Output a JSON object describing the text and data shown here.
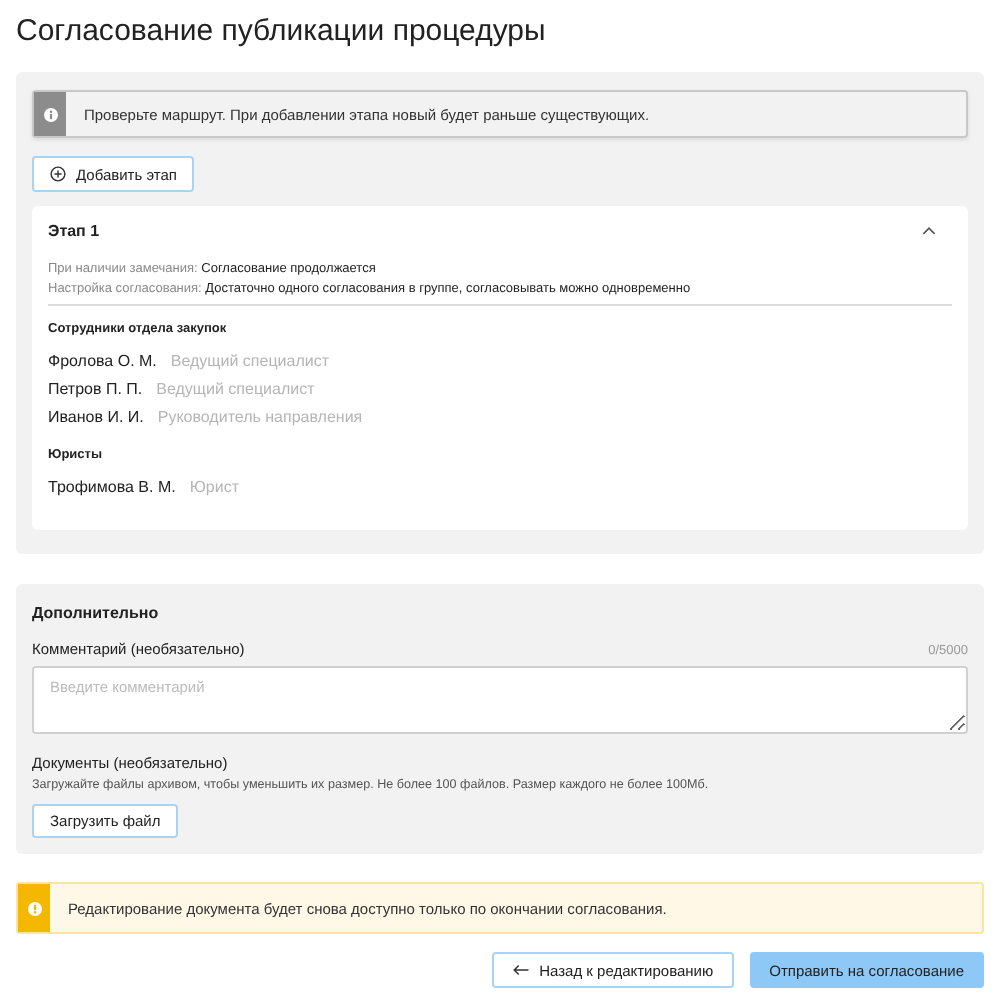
{
  "title": "Согласование публикации процедуры",
  "info_alert": {
    "text": "Проверьте маршрут. При добавлении этапа новый будет раньше существующих."
  },
  "add_stage_button": {
    "label": "Добавить этап"
  },
  "stages": [
    {
      "title": "Этап 1",
      "expanded": true,
      "settings": [
        {
          "label": "При наличии замечания:",
          "value": "Согласование продолжается"
        },
        {
          "label": "Настройка согласования:",
          "value": "Достаточно одного согласования в группе, согласовывать можно одновременно"
        }
      ],
      "groups": [
        {
          "name": "Сотрудники отдела закупок",
          "members": [
            {
              "name": "Фролова О. М.",
              "role": "Ведущий специалист"
            },
            {
              "name": "Петров П. П.",
              "role": "Ведущий специалист"
            },
            {
              "name": "Иванов И. И.",
              "role": "Руководитель направления"
            }
          ]
        },
        {
          "name": "Юристы",
          "members": [
            {
              "name": "Трофимова В. М.",
              "role": "Юрист"
            }
          ]
        }
      ]
    }
  ],
  "additional": {
    "title": "Дополнительно",
    "comment_label": "Комментарий (необязательно)",
    "comment_counter": "0/5000",
    "comment_placeholder": "Введите комментарий",
    "documents_label": "Документы (необязательно)",
    "documents_hint": "Загружайте файлы архивом, чтобы уменьшить их размер. Не более 100 файлов. Размер каждого не более 100Мб.",
    "upload_button": "Загрузить файл"
  },
  "warning_alert": {
    "text": "Редактирование документа будет снова доступно только по окончании согласования."
  },
  "buttons": [
    {
      "label": "Назад к редактированию",
      "kind": "back"
    },
    {
      "label": "Отправить на согласование",
      "kind": "primary"
    }
  ]
}
